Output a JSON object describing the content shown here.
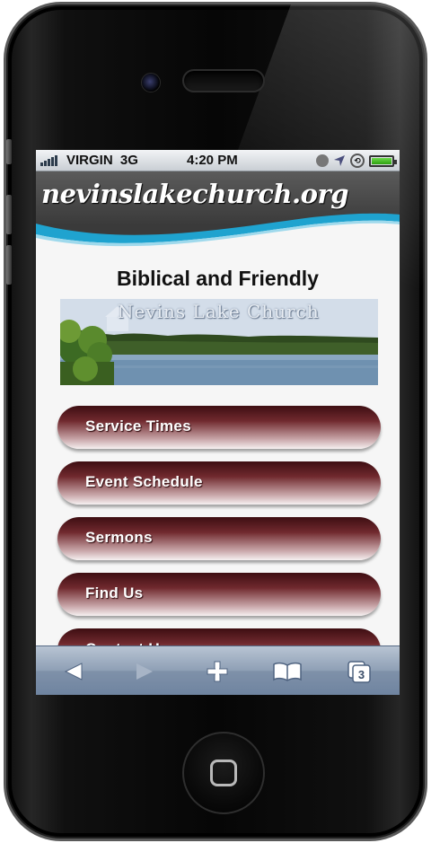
{
  "status_bar": {
    "carrier": "VIRGIN",
    "network": "3G",
    "time": "4:20 PM"
  },
  "site": {
    "title": "nevinslakechurch.org",
    "tagline": "Biblical and Friendly",
    "banner_text": "Nevins Lake Church"
  },
  "nav": {
    "items": [
      {
        "label": "Service Times"
      },
      {
        "label": "Event Schedule"
      },
      {
        "label": "Sermons"
      },
      {
        "label": "Find Us"
      },
      {
        "label": "Contact Us"
      }
    ]
  },
  "toolbar": {
    "tabs_count": "3",
    "icons": [
      "back-icon",
      "forward-icon",
      "add-icon",
      "bookmarks-icon",
      "tabs-icon"
    ]
  },
  "colors": {
    "button_dark": "#3e0e12",
    "button_mid": "#70292e",
    "header_bg": "#4a4a4a",
    "wave_blue": "#1fa3cf",
    "toolbar_blue": "#8e9fb5"
  }
}
